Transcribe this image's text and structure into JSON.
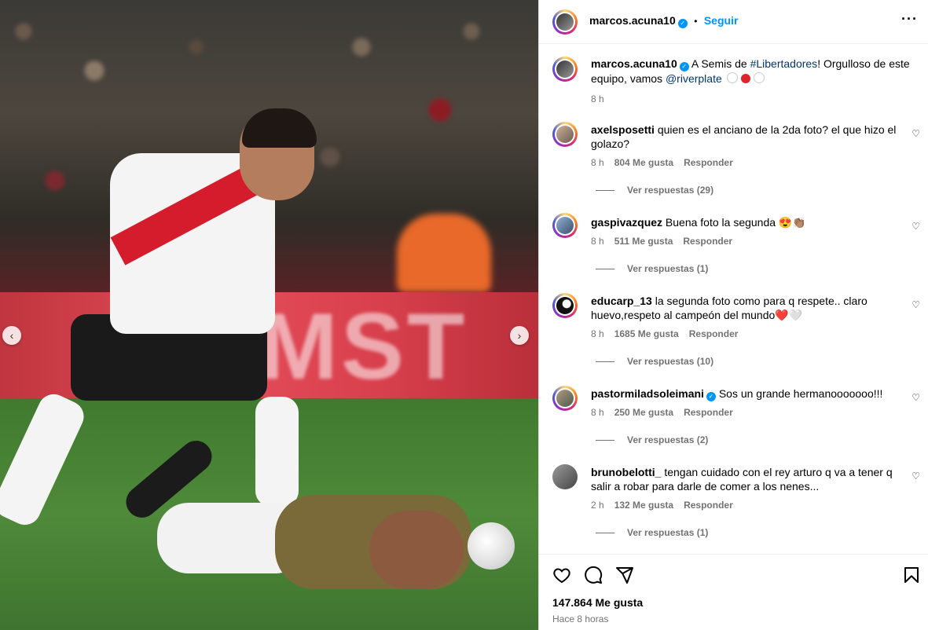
{
  "post": {
    "author": "marcos.acuna10",
    "follow_label": "Seguir",
    "caption_text_1": "A Semis de ",
    "caption_hashtag": "#Libertadores",
    "caption_text_2": "! Orgulloso de este equipo, vamos ",
    "caption_mention": "@riverplate",
    "caption_time": "8 h",
    "likes": "147.864 Me gusta",
    "posted_ago": "Hace 8 horas",
    "photo_text": "MST"
  },
  "comments": [
    {
      "user": "axelsposetti",
      "text": "quien es el anciano de la 2da foto? el que hizo el golazo?",
      "time": "8 h",
      "likes": "804 Me gusta",
      "reply": "Responder",
      "replies": "Ver respuestas (29)",
      "verified": false
    },
    {
      "user": "gaspivazquez",
      "text": "Buena foto la segunda 😍👏🏽",
      "time": "8 h",
      "likes": "511 Me gusta",
      "reply": "Responder",
      "replies": "Ver respuestas (1)",
      "verified": false
    },
    {
      "user": "educarp_13",
      "text": "la segunda foto como para q respete.. claro huevo,respeto al campeón del mundo❤️🤍",
      "time": "8 h",
      "likes": "1685 Me gusta",
      "reply": "Responder",
      "replies": "Ver respuestas (10)",
      "verified": false
    },
    {
      "user": "pastormiladsoleimani",
      "text": "Sos un grande hermanooooooo!!!",
      "time": "8 h",
      "likes": "250 Me gusta",
      "reply": "Responder",
      "replies": "Ver respuestas (2)",
      "verified": true
    },
    {
      "user": "brunobelotti_",
      "text": "tengan cuidado con el rey arturo q va a tener q salir a robar para darle de comer a los nenes...",
      "time": "2 h",
      "likes": "132 Me gusta",
      "reply": "Responder",
      "replies": "Ver respuestas (1)",
      "verified": false
    }
  ],
  "icons": {
    "options": "more-options-icon",
    "like": "heart-icon",
    "comment": "comment-icon",
    "share": "share-icon",
    "save": "bookmark-icon",
    "carousel_prev": "chevron-left-icon",
    "carousel_next": "chevron-right-icon"
  },
  "colors": {
    "accent": "#0095f6",
    "link": "#00376b",
    "muted": "#737373"
  }
}
